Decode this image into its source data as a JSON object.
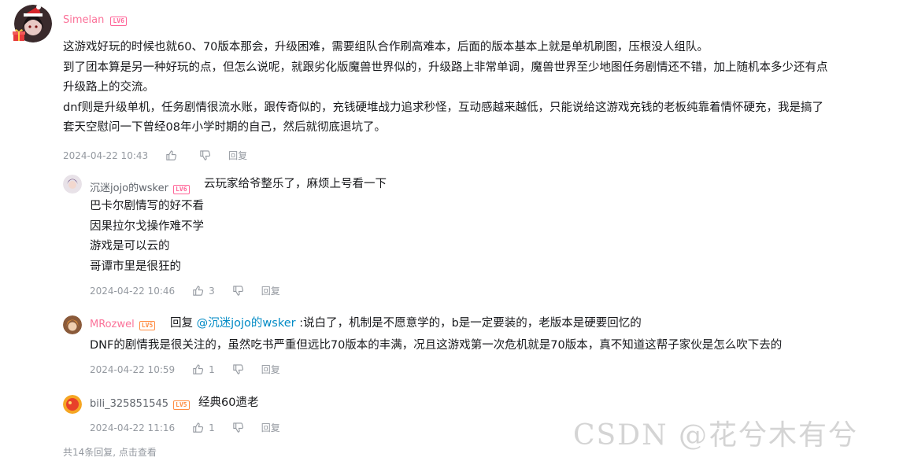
{
  "main_comment": {
    "user": "Simelan",
    "level": "LV6",
    "lines": [
      "这游戏好玩的时候也就60、70版本那会，升级困难，需要组队合作刷高难本，后面的版本基本上就是单机刷图，压根没人组队。",
      "到了团本算是另一种好玩的点，但怎么说呢，就跟劣化版魔兽世界似的，升级路上非常单调，魔兽世界至少地图任务剧情还不错，加上随机本多少还有点",
      "升级路上的交流。",
      "dnf则是升级单机，任务剧情很流水账，跟传奇似的，充钱硬堆战力追求秒怪，互动感越来越低，只能说给这游戏充钱的老板纯靠着情怀硬充，我是搞了",
      "套天空慰问一下曾经08年小学时期的自己，然后就彻底退坑了。"
    ],
    "time": "2024-04-22 10:43",
    "like_count": "",
    "reply_label": "回复"
  },
  "replies": [
    {
      "user": "沉迷jojo的wsker",
      "level": "LV6",
      "lines": [
        "云玩家给爷整乐了，麻烦上号看一下",
        "巴卡尔剧情写的好不看",
        "因果拉尔戈操作难不学",
        "游戏是可以云的",
        "哥谭市里是很狂的"
      ],
      "time": "2024-04-22 10:46",
      "like_count": "3",
      "reply_label": "回复"
    },
    {
      "user": "MRozwel",
      "level": "LV5",
      "reply_prefix": "回复 ",
      "reply_target": "@沉迷jojo的wsker",
      "reply_rest": " :说白了，机制是不愿意学的，b是一定要装的，老版本是硬要回忆的",
      "line2": "DNF的剧情我是很关注的，虽然吃书严重但远比70版本的丰满，况且这游戏第一次危机就是70版本，真不知道这帮子家伙是怎么吹下去的",
      "time": "2024-04-22 10:59",
      "like_count": "1",
      "reply_label": "回复"
    },
    {
      "user": "bili_325851545",
      "level": "LV5",
      "text": "经典60遗老",
      "time": "2024-04-22 11:16",
      "like_count": "1",
      "reply_label": "回复"
    }
  ],
  "footer": {
    "more_replies": "共14条回复, 点击查看"
  },
  "watermark": "CSDN @花兮木有兮",
  "colors": {
    "vip_name": "#fb7299",
    "link": "#008ac5",
    "level6": "#ff6699",
    "level5": "#ff8c42",
    "meta": "#9499a0"
  }
}
